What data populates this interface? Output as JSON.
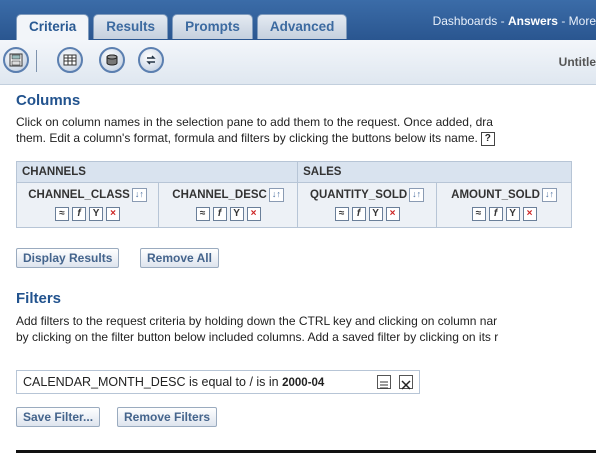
{
  "header": {
    "tabs": [
      {
        "label": "Criteria",
        "active": true
      },
      {
        "label": "Results",
        "active": false
      },
      {
        "label": "Prompts",
        "active": false
      },
      {
        "label": "Advanced",
        "active": false
      }
    ],
    "links": {
      "dashboards": "Dashboards",
      "sep1": " - ",
      "answers": "Answers",
      "sep2": " - ",
      "more": "More"
    }
  },
  "toolbar": {
    "icons": [
      "save-icon",
      "table-view-icon",
      "database-icon",
      "refresh-icon"
    ],
    "title": "Untitle"
  },
  "columns": {
    "heading": "Columns",
    "description_line1": "Click on column names in the selection pane to add them to the request. Once added, dra",
    "description_line2": "them. Edit a column's format, formula and filters by clicking the buttons below its name.",
    "help_label": "?",
    "groups": [
      {
        "name": "CHANNELS",
        "columns": [
          "CHANNEL_CLASS",
          "CHANNEL_DESC"
        ]
      },
      {
        "name": "SALES",
        "columns": [
          "QUANTITY_SOLD",
          "AMOUNT_SOLD"
        ]
      }
    ],
    "sort_glyph": "↓↑",
    "display_results": "Display Results",
    "remove_all": "Remove All"
  },
  "filters": {
    "heading": "Filters",
    "description_line1": "Add filters to the request criteria by holding down the CTRL key and clicking on column nar",
    "description_line2": "by clicking on the filter button below included columns. Add a saved filter by clicking on its r",
    "filter_text": "CALENDAR_MONTH_DESC is equal to / is in ",
    "filter_value": "2000-04",
    "save_filter": "Save Filter...",
    "remove_filters": "Remove Filters"
  },
  "colors": {
    "header_blue": "#2a5690",
    "heading_blue": "#22538e",
    "delete_red": "#cc2222"
  }
}
